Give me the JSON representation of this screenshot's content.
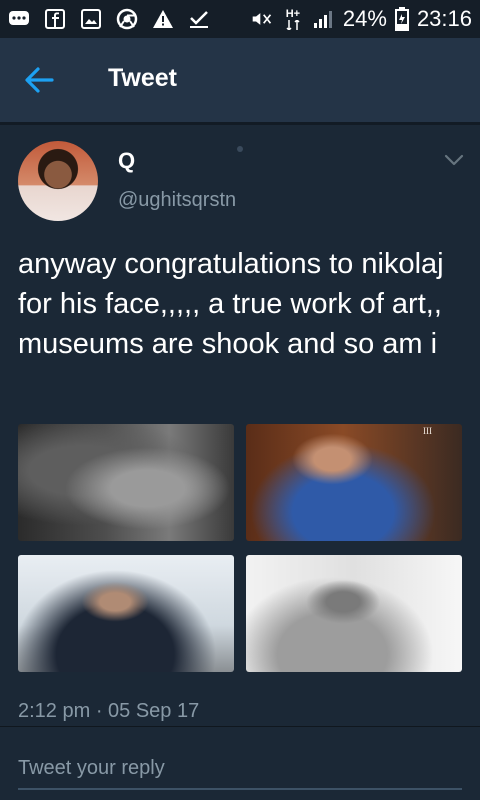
{
  "statusbar": {
    "left_icons": [
      "chat-icon",
      "facebook-icon",
      "image-icon",
      "chrome-icon",
      "warning-icon",
      "check-icon"
    ],
    "battery": "24%",
    "time": "23:16",
    "network": "H+"
  },
  "appbar": {
    "title": "Tweet"
  },
  "tweet": {
    "display_name": "Q",
    "handle": "@ughitsqrstn",
    "text": "anyway congratulations to nikolaj for his face,,,,, a true work of art,, museums are shook and so am i",
    "image_overlay_text": "III",
    "timestamp": "2:12 pm · 05 Sep 17"
  },
  "reply": {
    "placeholder": "Tweet your reply"
  },
  "colors": {
    "background": "#1b2836",
    "appbar": "#243447",
    "accent": "#1da1f2",
    "secondary_text": "#8899a6"
  }
}
